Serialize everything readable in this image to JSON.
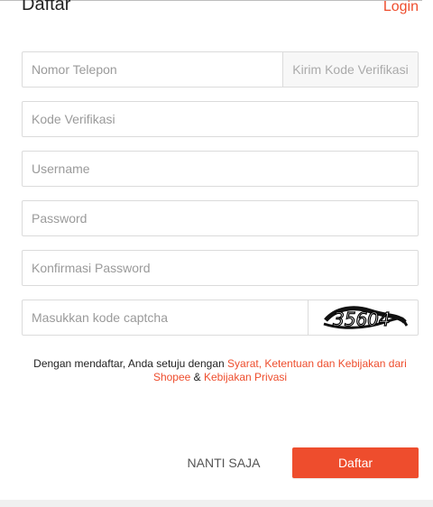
{
  "header": {
    "title": "Daftar",
    "login_label": "Login"
  },
  "form": {
    "phone_placeholder": "Nomor Telepon",
    "send_code_label": "Kirim Kode Verifikasi",
    "code_placeholder": "Kode Verifikasi",
    "username_placeholder": "Username",
    "password_placeholder": "Password",
    "confirm_password_placeholder": "Konfirmasi Password",
    "captcha_placeholder": "Masukkan kode captcha",
    "captcha_text": "35604"
  },
  "terms": {
    "prefix": "Dengan mendaftar, Anda setuju dengan ",
    "terms_link": "Syarat, Ketentuan dan Kebijakan dari Shopee",
    "connector": " & ",
    "privacy_link": "Kebijakan Privasi"
  },
  "actions": {
    "later_label": "NANTI SAJA",
    "submit_label": "Daftar"
  },
  "colors": {
    "accent": "#ee4d2d"
  }
}
